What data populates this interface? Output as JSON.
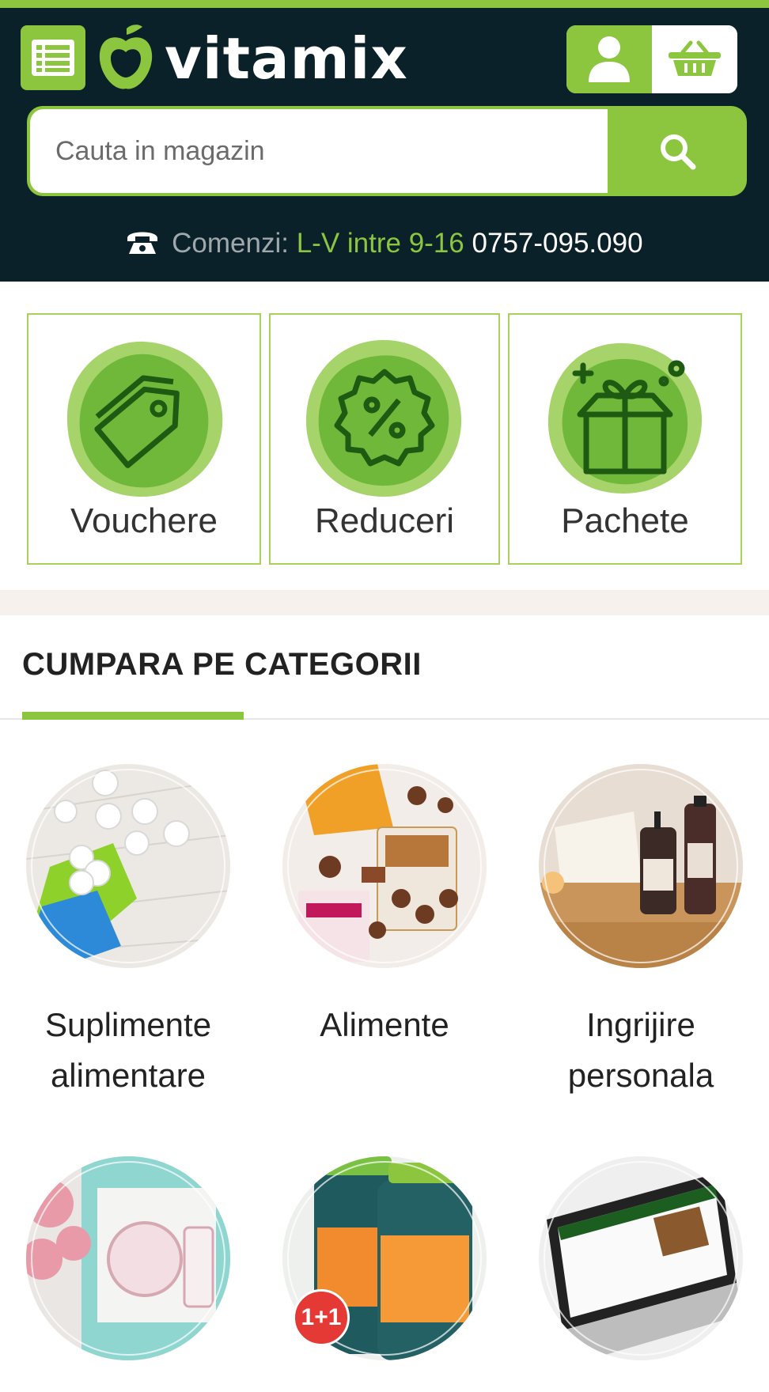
{
  "brand": {
    "name": "vitamix",
    "accent": "#8cc63f",
    "header_bg": "#0b2129"
  },
  "header": {
    "menu_icon": "menu-list-icon",
    "account_icon": "user-icon",
    "cart_icon": "basket-icon"
  },
  "search": {
    "placeholder": "Cauta in magazin",
    "button_icon": "search-icon"
  },
  "contact": {
    "label": "Comenzi:",
    "hours": "L-V intre 9-16",
    "phone": "0757-095.090",
    "icon": "phone-icon"
  },
  "promos": [
    {
      "label": "Vouchere",
      "icon": "price-tag-icon"
    },
    {
      "label": "Reduceri",
      "icon": "percent-badge-icon"
    },
    {
      "label": "Pachete",
      "icon": "gift-box-icon"
    }
  ],
  "categories": {
    "title": "CUMPARA PE CATEGORII",
    "items": [
      {
        "name": "Suplimente alimentare"
      },
      {
        "name": "Alimente"
      },
      {
        "name": "Ingrijire personala"
      },
      {
        "name": ""
      },
      {
        "name": "",
        "badge": "1+1"
      },
      {
        "name": ""
      }
    ]
  }
}
